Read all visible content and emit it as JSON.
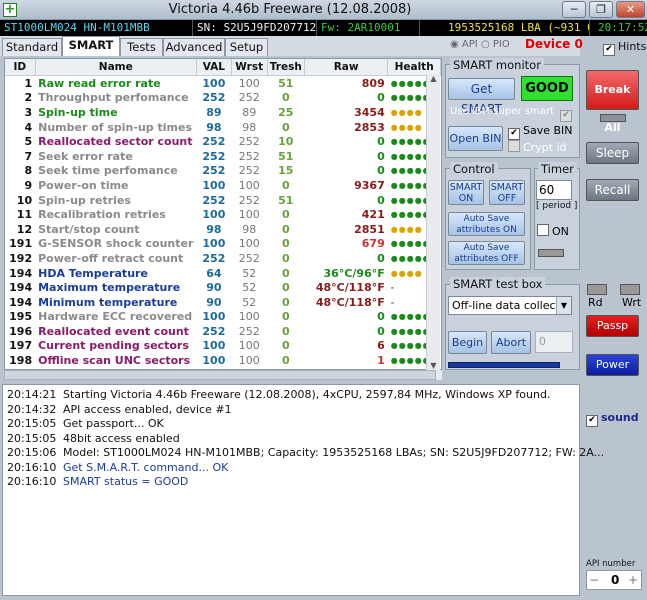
{
  "window": {
    "title": "Victoria 4.46b Freeware (12.08.2008)",
    "minimize": "─",
    "restore": "❐",
    "close": "✕"
  },
  "infobar": {
    "model": "ST1000LM024 HN-M101MBB",
    "serial": "SN: S2U5J9FD207712",
    "firmware": "Fw: 2AR10001",
    "capacity": "1953525168 LBA (~931 GB)",
    "clock": "20:17:52"
  },
  "tabs": [
    "Standard",
    "SMART",
    "Tests",
    "Advanced",
    "Setup"
  ],
  "mode": {
    "api": "API",
    "pio": "PIO",
    "device": "Device 0",
    "hints": "Hints"
  },
  "smart_table": {
    "headers": [
      "ID",
      "Name",
      "VAL",
      "Wrst",
      "Tresh",
      "Raw",
      "Health"
    ],
    "rows": [
      {
        "id": "1",
        "name": "Raw read error rate",
        "val": "100",
        "wrst": "100",
        "tresh": "51",
        "raw": "809",
        "health": "●●●●●",
        "name_color": "#1a8a1a",
        "raw_color": "#8a1a1a",
        "health_color": "#1a8a1a"
      },
      {
        "id": "2",
        "name": "Throughput perfomance",
        "val": "252",
        "wrst": "252",
        "tresh": "0",
        "raw": "0",
        "health": "●●●●●",
        "name_color": "#8a8a8a",
        "raw_color": "#1a8a1a",
        "health_color": "#1a8a1a"
      },
      {
        "id": "3",
        "name": "Spin-up time",
        "val": "89",
        "wrst": "89",
        "tresh": "25",
        "raw": "3454",
        "health": "●●●●",
        "name_color": "#1a8a1a",
        "raw_color": "#8a1a1a",
        "health_color": "#d9a400"
      },
      {
        "id": "4",
        "name": "Number of spin-up times",
        "val": "98",
        "wrst": "98",
        "tresh": "0",
        "raw": "2853",
        "health": "●●●●",
        "name_color": "#8a8a8a",
        "raw_color": "#8a1a1a",
        "health_color": "#d9a400"
      },
      {
        "id": "5",
        "name": "Reallocated sector count",
        "val": "252",
        "wrst": "252",
        "tresh": "10",
        "raw": "0",
        "health": "●●●●●",
        "name_color": "#8a1a6a",
        "raw_color": "#1a8a1a",
        "health_color": "#1a8a1a"
      },
      {
        "id": "7",
        "name": "Seek error rate",
        "val": "252",
        "wrst": "252",
        "tresh": "51",
        "raw": "0",
        "health": "●●●●●",
        "name_color": "#8a8a8a",
        "raw_color": "#1a8a1a",
        "health_color": "#1a8a1a"
      },
      {
        "id": "8",
        "name": "Seek time perfomance",
        "val": "252",
        "wrst": "252",
        "tresh": "15",
        "raw": "0",
        "health": "●●●●●",
        "name_color": "#8a8a8a",
        "raw_color": "#1a8a1a",
        "health_color": "#1a8a1a"
      },
      {
        "id": "9",
        "name": "Power-on time",
        "val": "100",
        "wrst": "100",
        "tresh": "0",
        "raw": "9367",
        "health": "●●●●●",
        "name_color": "#8a8a8a",
        "raw_color": "#8a1a1a",
        "health_color": "#1a8a1a"
      },
      {
        "id": "10",
        "name": "Spin-up retries",
        "val": "252",
        "wrst": "252",
        "tresh": "51",
        "raw": "0",
        "health": "●●●●●",
        "name_color": "#8a8a8a",
        "raw_color": "#1a8a1a",
        "health_color": "#1a8a1a"
      },
      {
        "id": "11",
        "name": "Recalibration retries",
        "val": "100",
        "wrst": "100",
        "tresh": "0",
        "raw": "421",
        "health": "●●●●●",
        "name_color": "#8a8a8a",
        "raw_color": "#8a1a1a",
        "health_color": "#1a8a1a"
      },
      {
        "id": "12",
        "name": "Start/stop count",
        "val": "98",
        "wrst": "98",
        "tresh": "0",
        "raw": "2851",
        "health": "●●●●",
        "name_color": "#8a8a8a",
        "raw_color": "#8a1a1a",
        "health_color": "#d9a400"
      },
      {
        "id": "191",
        "name": "G-SENSOR shock counter",
        "val": "100",
        "wrst": "100",
        "tresh": "0",
        "raw": "679",
        "health": "●●●●●",
        "name_color": "#8a8a8a",
        "raw_color": "#c83232",
        "health_color": "#1a8a1a"
      },
      {
        "id": "192",
        "name": "Power-off retract count",
        "val": "252",
        "wrst": "252",
        "tresh": "0",
        "raw": "0",
        "health": "●●●●●",
        "name_color": "#8a8a8a",
        "raw_color": "#1a8a1a",
        "health_color": "#1a8a1a"
      },
      {
        "id": "194",
        "name": "HDA Temperature",
        "val": "64",
        "wrst": "52",
        "tresh": "0",
        "raw": "36°C/96°F",
        "health": "●●●●",
        "name_color": "#1a3c9a",
        "raw_color": "#1a8a1a",
        "health_color": "#d9a400"
      },
      {
        "id": "194",
        "name": "Maximum temperature",
        "val": "90",
        "wrst": "52",
        "tresh": "0",
        "raw": "48°C/118°F",
        "health": "-",
        "name_color": "#1a3c9a",
        "raw_color": "#8a1a1a",
        "health_color": "#555555"
      },
      {
        "id": "194",
        "name": "Minimum temperature",
        "val": "90",
        "wrst": "52",
        "tresh": "0",
        "raw": "48°C/118°F",
        "health": "-",
        "name_color": "#1a3c9a",
        "raw_color": "#8a1a1a",
        "health_color": "#555555"
      },
      {
        "id": "195",
        "name": "Hardware ECC recovered",
        "val": "100",
        "wrst": "100",
        "tresh": "0",
        "raw": "0",
        "health": "●●●●●",
        "name_color": "#8a8a8a",
        "raw_color": "#1a8a1a",
        "health_color": "#1a8a1a"
      },
      {
        "id": "196",
        "name": "Reallocated event count",
        "val": "252",
        "wrst": "252",
        "tresh": "0",
        "raw": "0",
        "health": "●●●●●",
        "name_color": "#8a1a6a",
        "raw_color": "#1a8a1a",
        "health_color": "#1a8a1a"
      },
      {
        "id": "197",
        "name": "Current pending sectors",
        "val": "100",
        "wrst": "100",
        "tresh": "0",
        "raw": "6",
        "health": "●●●●●",
        "name_color": "#8a1a6a",
        "raw_color": "#8a1a1a",
        "health_color": "#1a8a1a"
      },
      {
        "id": "198",
        "name": "Offline scan UNC sectors",
        "val": "100",
        "wrst": "100",
        "tresh": "0",
        "raw": "1",
        "health": "●●●●●",
        "name_color": "#8a1a6a",
        "raw_color": "#c83232",
        "health_color": "#1a8a1a"
      }
    ]
  },
  "smart_monitor": {
    "title": "SMART monitor",
    "get_smart": "Get SMART",
    "status": "GOOD",
    "ibm_super": "Use IBM super smart",
    "open_bin": "Open BIN",
    "save_bin": "Save BIN",
    "crypt_id": "Crypt id"
  },
  "control": {
    "title": "Control",
    "smart_on": "SMART ON",
    "smart_off": "SMART OFF",
    "autosave_on": "Auto Save attributes ON",
    "autosave_off": "Auto Save attributes OFF"
  },
  "timer": {
    "title": "Timer",
    "value": "60",
    "period": "[ period ]",
    "on": "ON"
  },
  "test_box": {
    "title": "SMART test box",
    "selected": "Off-line data collect",
    "begin": "Begin",
    "abort": "Abort",
    "field": "0"
  },
  "side": {
    "break_all": "Break All",
    "sleep": "Sleep",
    "recall": "Recall",
    "rd": "Rd",
    "wrt": "Wrt",
    "passp": "Passp",
    "power": "Power",
    "sound": "sound",
    "api_number": "API number",
    "api_minus": "−",
    "api_value": "0",
    "api_plus": "+"
  },
  "log": [
    {
      "time": "20:14:21",
      "text": "Starting Victoria 4.46b Freeware (12.08.2008), 4xCPU, 2597,84 MHz, Windows XP found.",
      "color": "#111111"
    },
    {
      "time": "20:14:32",
      "text": "API access enabled, device #1",
      "color": "#111111"
    },
    {
      "time": "20:15:05",
      "text": "Get passport... OK",
      "color": "#111111"
    },
    {
      "time": "20:15:05",
      "text": "48bit access enabled",
      "color": "#111111"
    },
    {
      "time": "20:15:06",
      "text": "Model: ST1000LM024 HN-M101MBB; Capacity: 1953525168 LBAs; SN: S2U5J9FD207712; FW: 2A...",
      "color": "#111111"
    },
    {
      "time": "20:16:10",
      "text": "Get S.M.A.R.T. command... OK",
      "color": "#1a3c9a"
    },
    {
      "time": "20:16:10",
      "text": "SMART status = GOOD",
      "color": "#1a3c9a"
    }
  ]
}
